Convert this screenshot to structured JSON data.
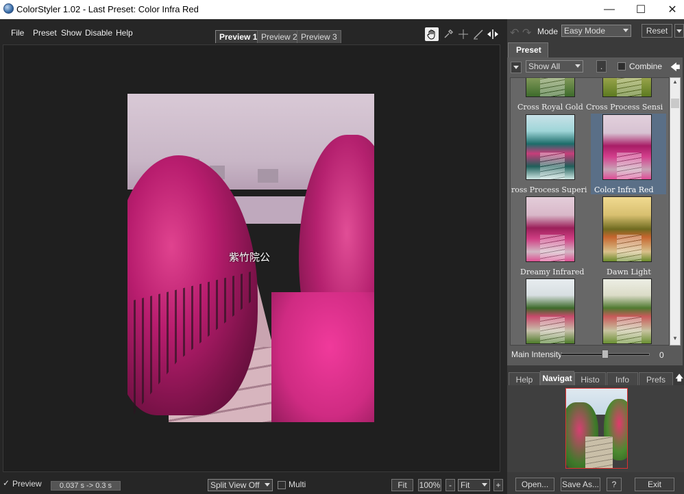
{
  "window": {
    "title": "ColorStyler 1.02 - Last Preset: Color Infra Red",
    "min": "—",
    "max": "☐",
    "close": "✕"
  },
  "menu": [
    "File",
    "Preset",
    "Show",
    "Disable",
    "Help"
  ],
  "preview_tabs": [
    "Preview 1",
    "Preview 2",
    "Preview 3"
  ],
  "tools": {
    "hand": "hand-icon",
    "dropper": "eyedropper-icon",
    "crosshair": "crosshair-icon",
    "brush": "brush-icon",
    "split": "split-arrows-icon"
  },
  "undo_icon": "↶",
  "redo_icon": "↷",
  "mode": {
    "label": "Mode",
    "value": "Easy Mode"
  },
  "reset_label": "Reset",
  "watermark": "紫竹院公",
  "status": {
    "preview_label": "Preview",
    "timing": "0.037 s -> 0.3 s",
    "split_view": "Split View Off",
    "multi_label": "Multi",
    "fit": "Fit",
    "zoom": "100%",
    "minus": "-",
    "fit_select": "Fit",
    "plus": "+"
  },
  "preset_panel": {
    "tab": "Preset",
    "show": "Show All",
    "dot_button": ".",
    "combine_label": "Combine",
    "back_arrow": "🡄",
    "presets": [
      {
        "label": "Cross Royal Gold",
        "style": "royalgold"
      },
      {
        "label": "Cross Process Sensi",
        "style": "sensi"
      },
      {
        "label": "ross Process Superi",
        "style": "superi"
      },
      {
        "label": "Color Infra Red",
        "style": "infrared",
        "selected": true
      },
      {
        "label": "Dreamy Infrared",
        "style": "dreamy"
      },
      {
        "label": "Dawn Light",
        "style": "dawn"
      },
      {
        "label": "",
        "style": "natural1"
      },
      {
        "label": "",
        "style": "natural2"
      }
    ],
    "intensity_label": "Main Intensity",
    "intensity_value": "0",
    "intensity_fraction": 0.5
  },
  "bottom_tabs": [
    "Help",
    "Navigat",
    "Histo",
    "Info",
    "Prefs"
  ],
  "up_arrow": "🡅",
  "actions": {
    "open": "Open...",
    "save": "Save As...",
    "help": "?",
    "exit": "Exit"
  }
}
